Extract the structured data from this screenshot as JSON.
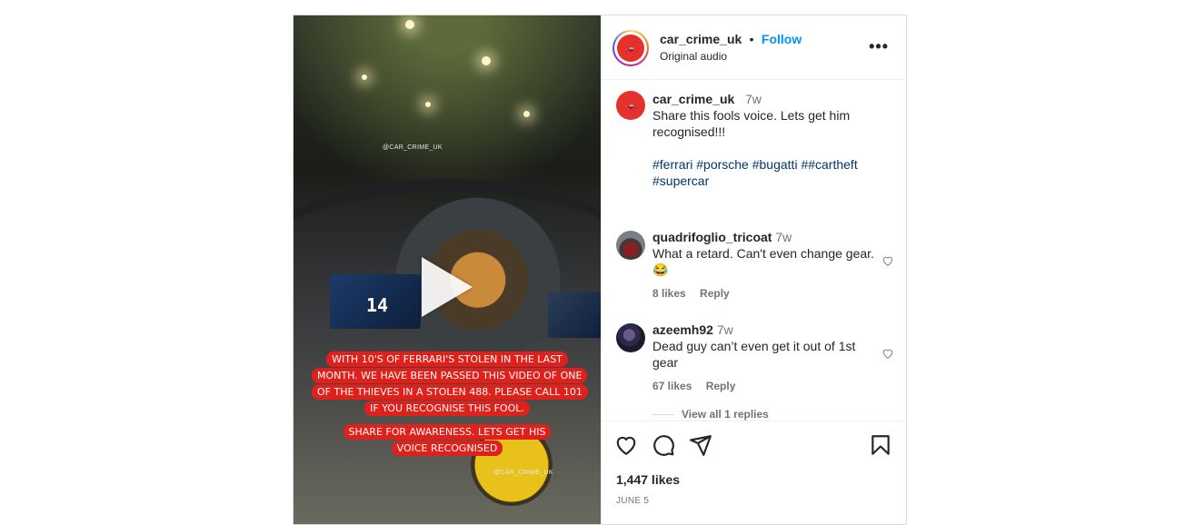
{
  "post": {
    "author": "car_crime_uk",
    "follow_label": "Follow",
    "audio_label": "Original audio",
    "more_label": "•••"
  },
  "video": {
    "watermark_top": "@CAR_CRIME_UK",
    "watermark_bottom": "@CAR_CRIME_UK",
    "overlay_text_1": "WITH 10'S OF FERRARI'S STOLEN IN THE LAST MONTH. WE HAVE BEEN PASSED THIS VIDEO OF ONE OF THE THIEVES IN A STOLEN 488. PLEASE CALL 101 IF YOU RECOGNISE THIS FOOL.",
    "overlay_text_2": "SHARE FOR AWARENESS. LETS GET HIS VOICE RECOGNISED",
    "speed": "14"
  },
  "caption": {
    "username": "car_crime_uk",
    "time": "7w",
    "text": "Share this fools voice. Lets get him recognised!!!",
    "hashtags": [
      {
        "text": "#ferrari"
      },
      {
        "text": "#porsche"
      },
      {
        "text": "#bugatti"
      },
      {
        "text": "##cartheft"
      },
      {
        "text": "#supercar"
      }
    ]
  },
  "comments": [
    {
      "username": "quadrifoglio_tricoat",
      "time": "7w",
      "text": "What a retard. Can't even change gear. 😂",
      "likes": "8 likes",
      "reply_label": "Reply"
    },
    {
      "username": "azeemh92",
      "time": "7w",
      "text": "Dead guy can’t even get it out of 1st gear",
      "likes": "67 likes",
      "reply_label": "Reply"
    }
  ],
  "view_replies_label": "View all 1 replies",
  "likes_count": "1,447 likes",
  "post_date": "JUNE 5",
  "colors": {
    "brand_red": "#e4312b",
    "link_blue": "#0095f6",
    "hashtag_blue": "#00376b",
    "muted": "#737373"
  }
}
